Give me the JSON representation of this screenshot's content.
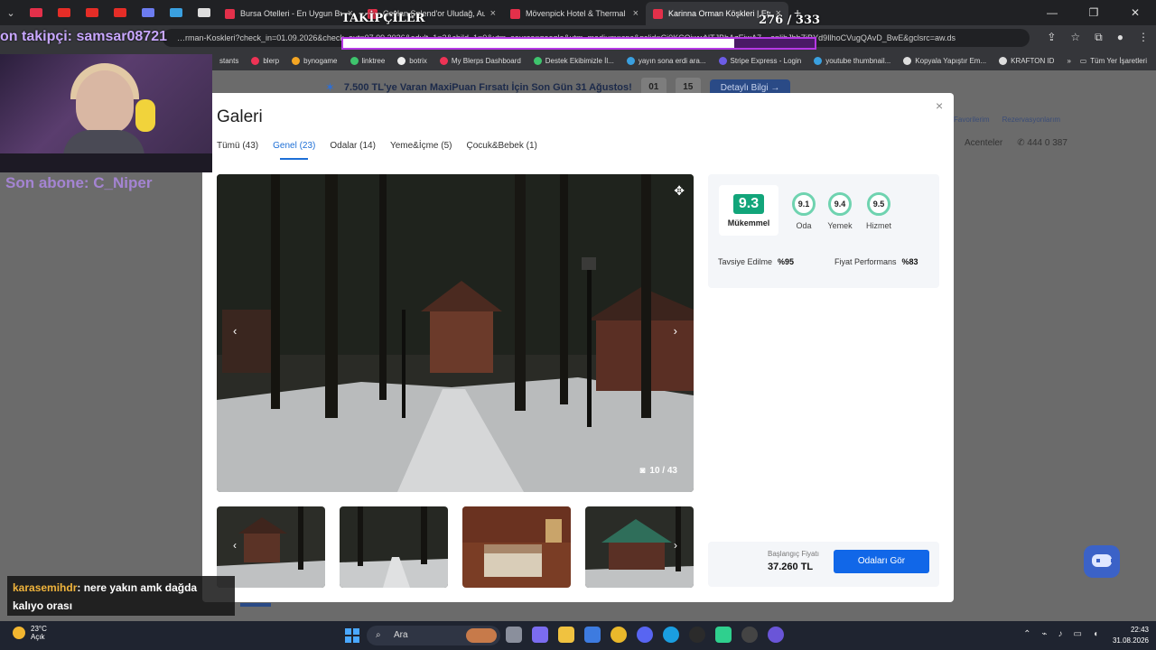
{
  "browser": {
    "tabs": [
      {
        "title": "Bursa Otelleri - En Uygun Bursa",
        "active": false
      },
      {
        "title": "Ceylan Şplend'or Uludağ, Auto",
        "active": false
      },
      {
        "title": "Mövenpick Hotel & Thermal Sp",
        "active": false
      },
      {
        "title": "Karinna Orman Köşkleri | Etstur",
        "active": true
      }
    ],
    "url": "…rman-Koskleri?check_in=01.09.2026&check_out=07.09.2026&adult_1=2&child_1=0&utm_source=google&utm_medium=cpc&gclid=Cj0KCQiwwNTJBhAzEiwA7__aplihJbbZiBYd9IlhoCVugQAvD_BwE&gclsrc=aw.ds",
    "bookmarks": [
      "stants",
      "blerp",
      "bynogame",
      "linktree",
      "botrix",
      "My Blerps Dashboard",
      "Destek Ekibimizle İl...",
      "yayın sona erdi ara...",
      "Stripe Express - Login",
      "youtube thumbnail...",
      "Kopyala Yapıştır Em...",
      "KRAFTON ID"
    ],
    "bookmarks_right": "Tüm Yer İşaretleri"
  },
  "background_page": {
    "promo_text": "7.500 TL'ye Varan MaxiPuan Fırsatı İçin Son Gün 31 Ağustos!",
    "countdown": [
      "01",
      "15"
    ],
    "promo_button": "Detaylı Bilgi →",
    "links": [
      "Favorilerim",
      "Rezervasyonlarım"
    ],
    "contact": [
      "Acenteler",
      "444 0 387"
    ]
  },
  "gallery": {
    "title": "Galeri",
    "close": "×",
    "tabs": [
      {
        "label": "Tümü (43)",
        "active": false
      },
      {
        "label": "Genel (23)",
        "active": true
      },
      {
        "label": "Odalar (14)",
        "active": false
      },
      {
        "label": "Yeme&İçme (5)",
        "active": false
      },
      {
        "label": "Çocuk&Bebek (1)",
        "active": false
      }
    ],
    "photo_counter": "10 / 43",
    "scores": {
      "overall": "9.3",
      "overall_label": "Mükemmel",
      "sub": [
        {
          "value": "9.1",
          "label": "Oda"
        },
        {
          "value": "9.4",
          "label": "Yemek"
        },
        {
          "value": "9.5",
          "label": "Hizmet"
        }
      ],
      "recommend_label": "Tavsiye Edilme",
      "recommend_value": "%95",
      "price_perf_label": "Fiyat Performans",
      "price_perf_value": "%83"
    },
    "price": {
      "label": "Başlangıç Fiyatı",
      "value": "37.260 TL",
      "button": "Odaları Gör"
    }
  },
  "stream_overlay": {
    "follower_ticker": "on takipçi: samsar08721",
    "last_sub": "Son abone: C_Niper",
    "goal_label": "TAKİPÇİLER",
    "goal_count": "276 / 333",
    "goal_progress": 0.83,
    "chat": {
      "user": "karasemihdr",
      "message": ": nere yakın amk dağda kalıyo orası"
    }
  },
  "taskbar": {
    "temperature": "23°C",
    "weather": "Açık",
    "search_placeholder": "Ara",
    "time": "22:43",
    "date": "31.08.2026"
  },
  "colors": {
    "accent": "#1167e8",
    "score_green": "#12a57a",
    "overlay_purple": "#b638e6"
  }
}
